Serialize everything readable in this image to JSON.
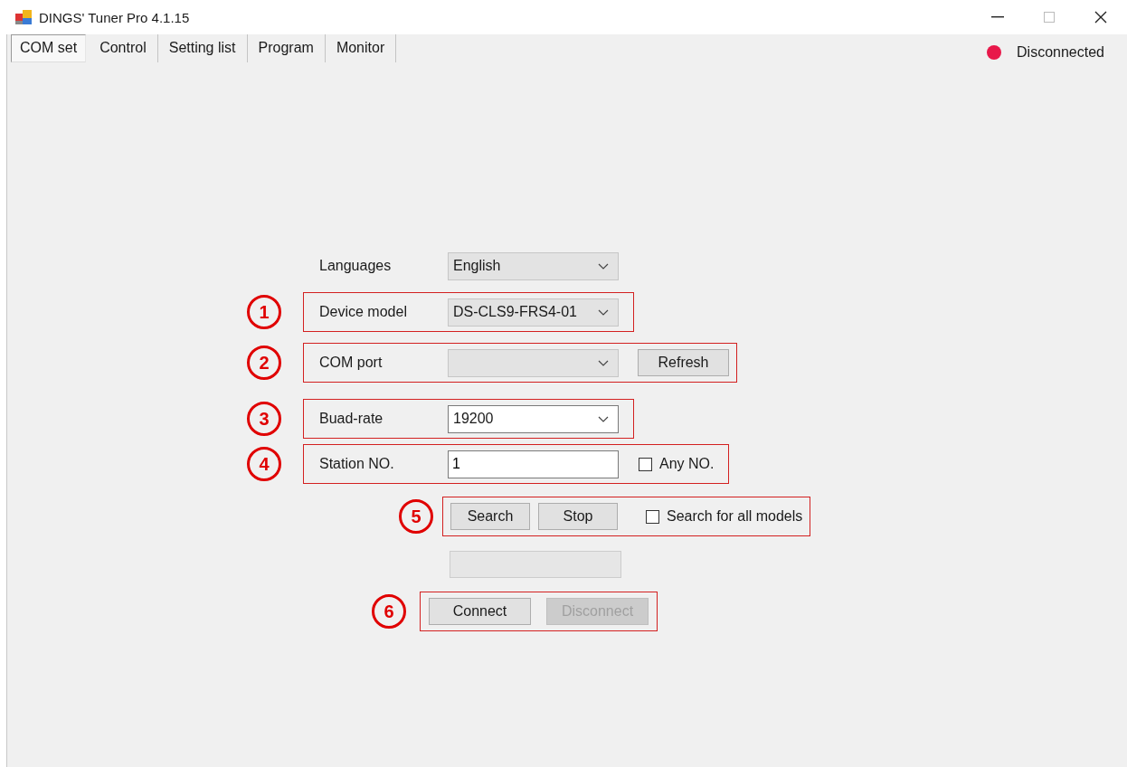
{
  "window": {
    "title": "DINGS' Tuner Pro 4.1.15"
  },
  "tabs": [
    {
      "label": "COM set",
      "selected": true
    },
    {
      "label": "Control",
      "selected": false
    },
    {
      "label": "Setting list",
      "selected": false
    },
    {
      "label": "Program",
      "selected": false
    },
    {
      "label": "Monitor",
      "selected": false
    }
  ],
  "status": {
    "label": "Disconnected",
    "connected": false
  },
  "rows": [
    {
      "label": "Languages",
      "control": {
        "kind": "combo",
        "value": "English",
        "editable": false
      }
    },
    {
      "marker": "1",
      "label": "Device model",
      "control": {
        "kind": "combo",
        "value": "DS-CLS9-FRS4-01",
        "editable": false
      }
    },
    {
      "marker": "2",
      "label": "COM port",
      "control": {
        "kind": "combo",
        "editable": false
      },
      "buttons": [
        {
          "label": "Refresh",
          "disabled": false
        }
      ]
    },
    {
      "marker": "3",
      "label": "Buad-rate",
      "control": {
        "kind": "combo",
        "value": "19200",
        "editable": true
      }
    },
    {
      "marker": "4",
      "label": "Station NO.",
      "control": {
        "kind": "text",
        "value": "1"
      },
      "checkbox": {
        "label": "Any NO.",
        "checked": false
      }
    },
    {
      "marker": "5",
      "buttons": [
        {
          "label": "Search",
          "disabled": false
        },
        {
          "label": "Stop",
          "disabled": false
        }
      ],
      "checkbox": {
        "label": "Search for all models",
        "checked": false
      }
    },
    {
      "control": {
        "kind": "blank",
        "disabled": true
      }
    },
    {
      "marker": "6",
      "buttons": [
        {
          "label": "Connect",
          "disabled": false
        },
        {
          "label": "Disconnect",
          "disabled": true
        }
      ]
    }
  ]
}
